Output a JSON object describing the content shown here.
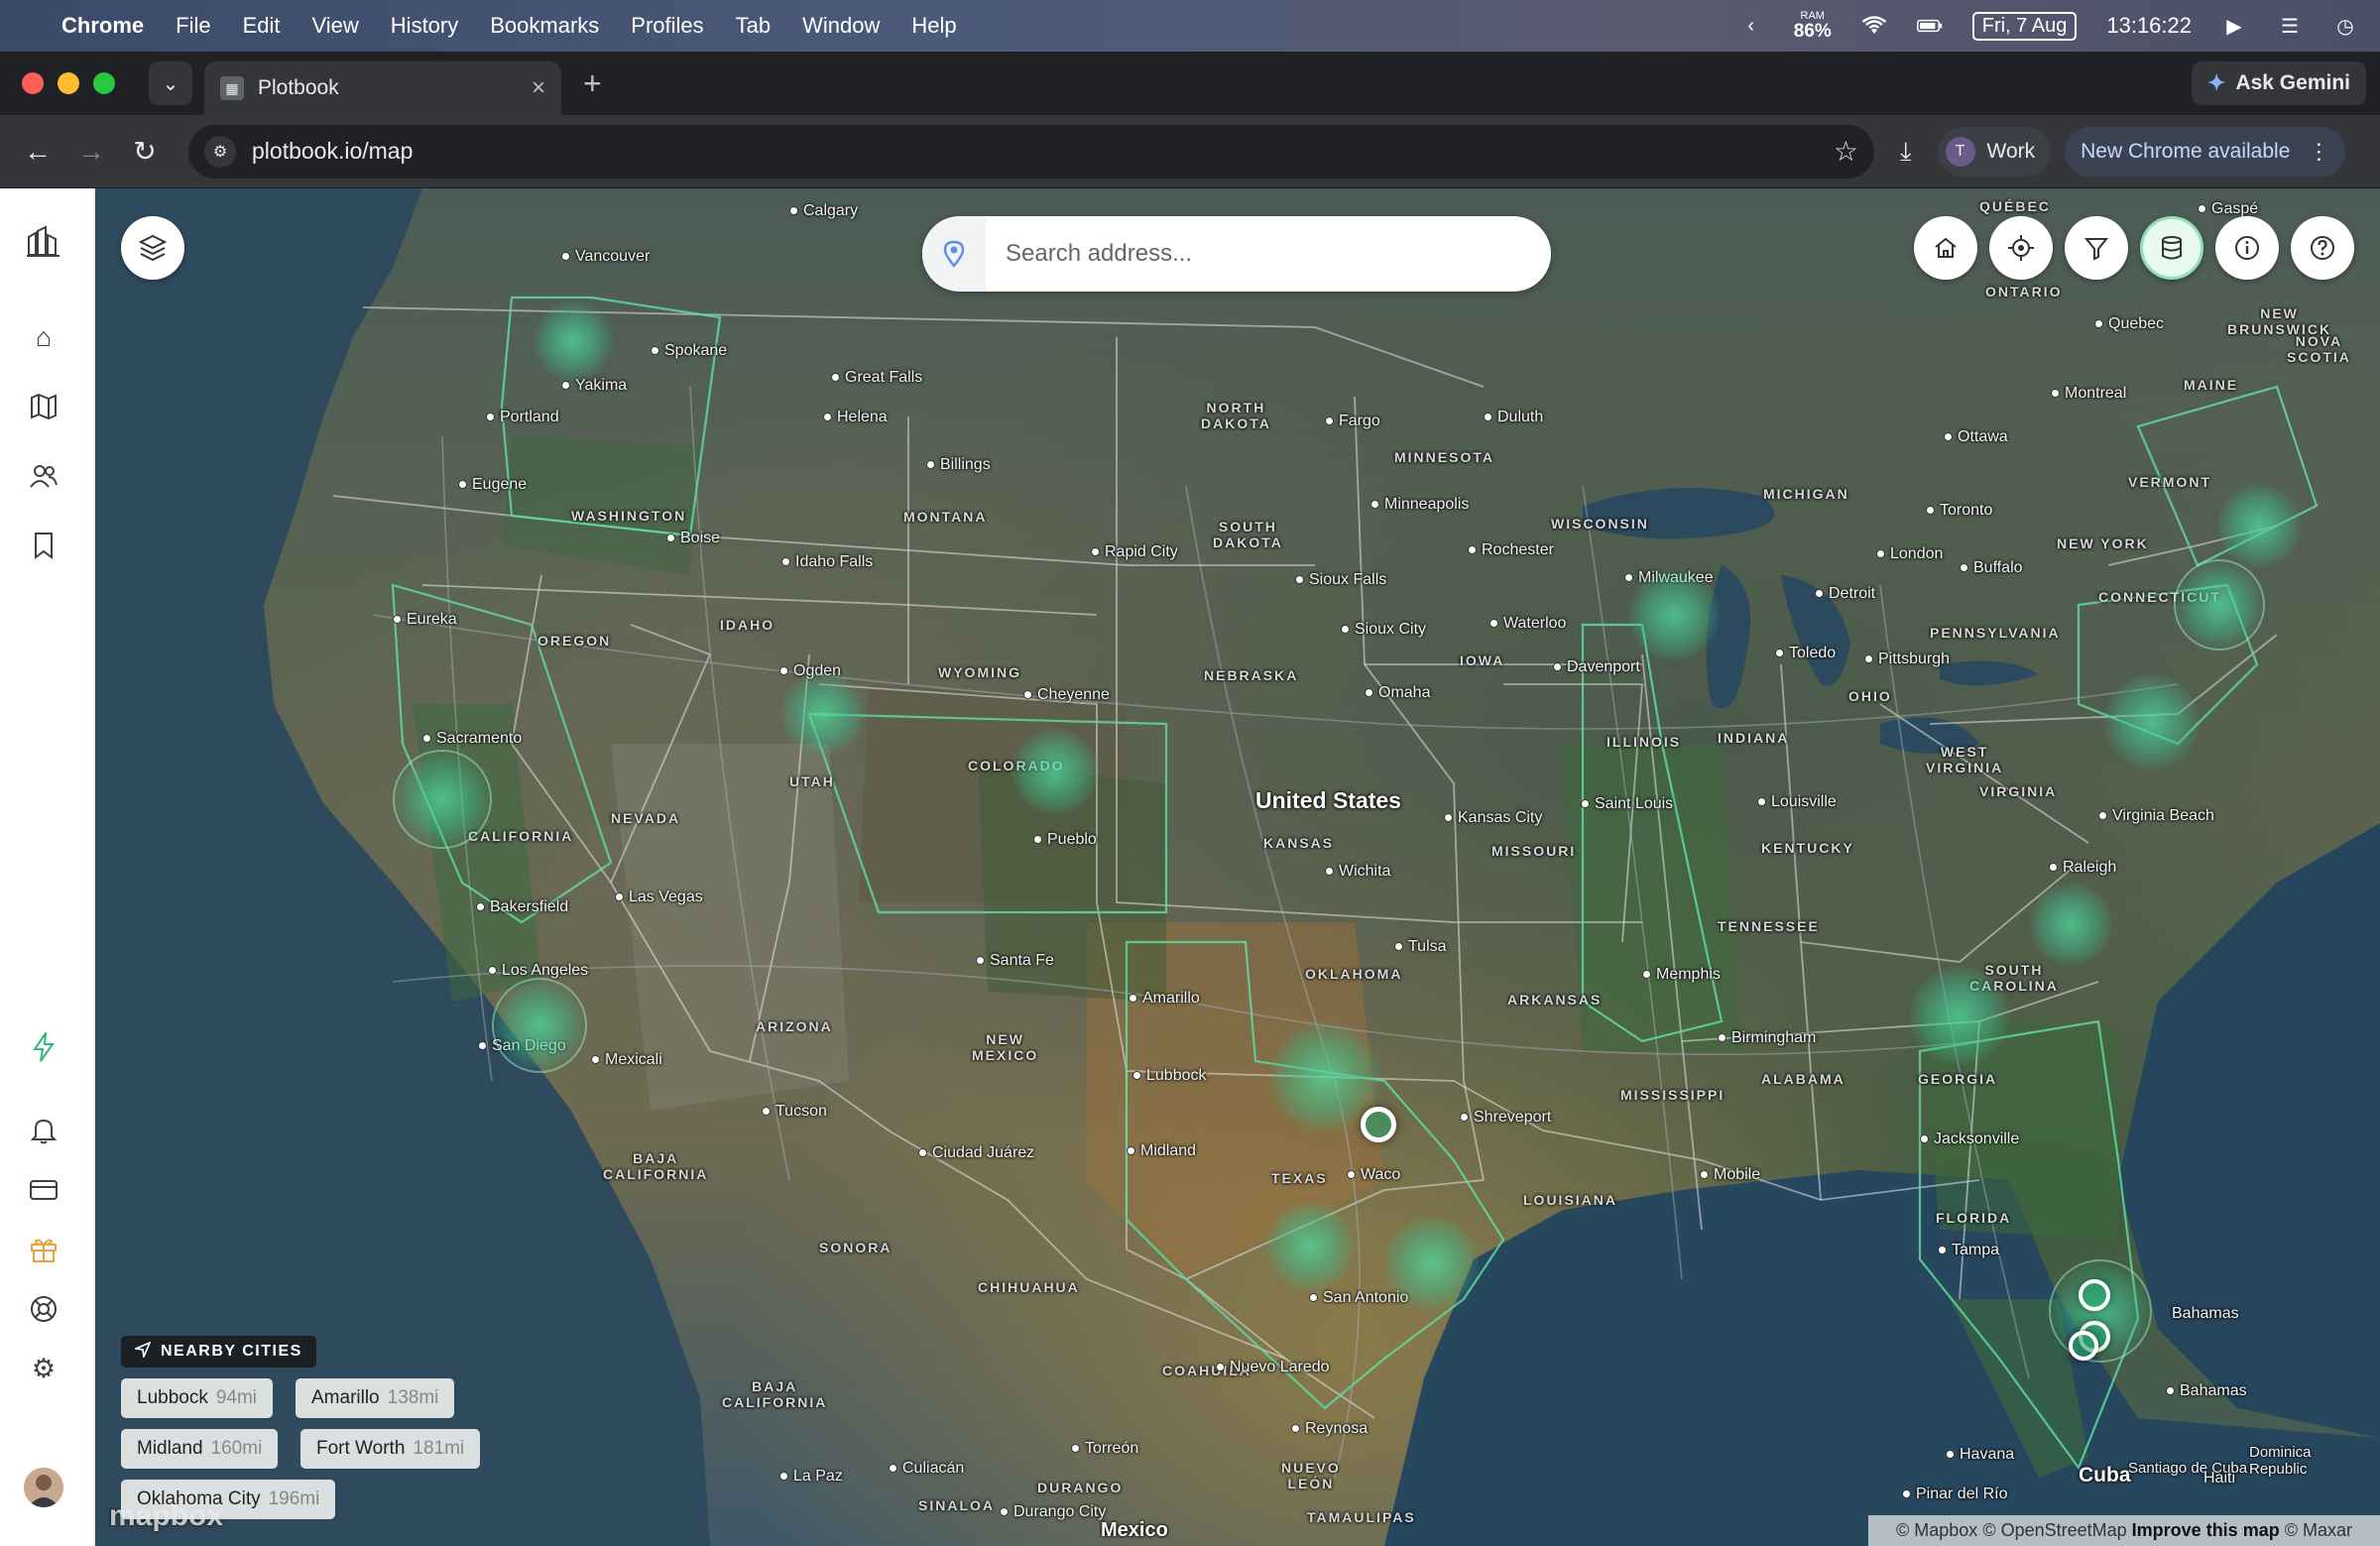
{
  "menubar": {
    "app": "Chrome",
    "items": [
      "File",
      "Edit",
      "View",
      "History",
      "Bookmarks",
      "Profiles",
      "Tab",
      "Window",
      "Help"
    ],
    "ram_label": "RAM",
    "ram_value": "86%",
    "date": "Fri, 7 Aug",
    "time": "13:16:22"
  },
  "browser": {
    "tab_title": "Plotbook",
    "ask_gemini": "Ask Gemini",
    "url": "plotbook.io/map",
    "profile_initial": "T",
    "profile_name": "Work",
    "update_label": "New Chrome available"
  },
  "map": {
    "search_placeholder": "Search address...",
    "country_label": "United States",
    "labels": {
      "calgary": "Calgary",
      "vancouver": "Vancouver",
      "spokane": "Spokane",
      "yakima": "Yakima",
      "portland": "Portland",
      "eugene": "Eugene",
      "eureka": "Eureka",
      "sacramento": "Sacramento",
      "bakersfield": "Bakersfield",
      "los_angeles": "Los Angeles",
      "san_diego": "San Diego",
      "mexicali": "Mexicali",
      "las_vegas": "Las Vegas",
      "boise": "Boise",
      "idaho_falls": "Idaho Falls",
      "ogden": "Ogden",
      "great_falls": "Great Falls",
      "helena": "Helena",
      "billings": "Billings",
      "rapid_city": "Rapid City",
      "cheyenne": "Cheyenne",
      "pueblo": "Pueblo",
      "santa_fe": "Santa Fe",
      "tucson": "Tucson",
      "ciudad_juarez": "Ciudad Juárez",
      "amarillo": "Amarillo",
      "lubbock": "Lubbock",
      "midland": "Midland",
      "fargo": "Fargo",
      "duluth": "Duluth",
      "minneapolis": "Minneapolis",
      "rochester": "Rochester",
      "sioux_falls": "Sioux Falls",
      "sioux_city": "Sioux City",
      "omaha": "Omaha",
      "waterloo": "Waterloo",
      "davenport": "Davenport",
      "milwaukee": "Milwaukee",
      "detroit": "Detroit",
      "toledo": "Toledo",
      "pittsburgh": "Pittsburgh",
      "toronto": "Toronto",
      "london": "London",
      "buffalo": "Buffalo",
      "ottawa": "Ottawa",
      "montreal": "Montreal",
      "quebec": "Quebec",
      "gaspe": "Gaspé",
      "kansas_city": "Kansas City",
      "saint_louis": "Saint Louis",
      "wichita": "Wichita",
      "tulsa": "Tulsa",
      "louisville": "Louisville",
      "virginia_beach": "Virginia Beach",
      "raleigh": "Raleigh",
      "memphis": "Memphis",
      "birmingham": "Birmingham",
      "shreveport": "Shreveport",
      "waco": "Waco",
      "san_antonio": "San Antonio",
      "jacksonville": "Jacksonville",
      "mobile": "Mobile",
      "tampa": "Tampa",
      "nuevo_laredo": "Nuevo Laredo",
      "reynosa": "Reynosa",
      "torreon": "Torreón",
      "culiacan": "Culiacán",
      "durango": "Durango City",
      "la_paz": "La Paz",
      "havana": "Havana",
      "cuba": "Cuba",
      "bahamas": "Bahamas",
      "mexico": "Mexico",
      "pinar": "Pinar del Río",
      "santiago": "Santiago de Cuba",
      "haiti": "Haiti",
      "dominican": "Dominica\nRepublic"
    },
    "states": {
      "wa": "WASHINGTON",
      "or": "OREGON",
      "ca": "CALIFORNIA",
      "nv": "NEVADA",
      "id": "IDAHO",
      "mt": "MONTANA",
      "wy": "WYOMING",
      "ut": "UTAH",
      "co": "COLORADO",
      "az": "ARIZONA",
      "nm": "NEW\nMEXICO",
      "nd": "NORTH\nDAKOTA",
      "sd": "SOUTH\nDAKOTA",
      "ne": "NEBRASKA",
      "ks": "KANSAS",
      "ok": "OKLAHOMA",
      "tx": "TEXAS",
      "mn": "MINNESOTA",
      "ia": "IOWA",
      "mo": "MISSOURI",
      "ar": "ARKANSAS",
      "la": "LOUISIANA",
      "wi": "WISCONSIN",
      "il": "ILLINOIS",
      "mi": "MICHIGAN",
      "in": "INDIANA",
      "oh": "OHIO",
      "ky": "KENTUCKY",
      "tn": "TENNESSEE",
      "ms": "MISSISSIPPI",
      "al": "ALABAMA",
      "ga": "GEORGIA",
      "fl": "FLORIDA",
      "sc": "SOUTH\nCAROLINA",
      "va": "VIRGINIA",
      "wv": "WEST\nVIRGINIA",
      "pa": "PENNSYLVANIA",
      "ny": "NEW YORK",
      "vt": "VERMONT",
      "me": "MAINE",
      "ontario": "ONTARIO",
      "quebec": "QUÉBEC",
      "nb": "NEW\nBRUNSWICK",
      "nova": "NOVA\nSCOTIA",
      "sonora": "SONORA",
      "chihuahua": "CHIHUAHUA",
      "coahuila": "COAHUILA",
      "baja": "BAJA\nCALIFORNIA",
      "nuevo_leon": "NUEVO\nLEÓN",
      "tamaulipas": "TAMAULIPAS",
      "sinaloa": "SINALOA",
      "durango_st": "DURANGO",
      "conn": "CONNECTICUT",
      "baja_sur": "BAJA\nCALIFORNIA"
    }
  },
  "nearby": {
    "heading": "NEARBY CITIES",
    "cities": [
      {
        "name": "Lubbock",
        "dist": "94mi"
      },
      {
        "name": "Amarillo",
        "dist": "138mi"
      },
      {
        "name": "Midland",
        "dist": "160mi"
      },
      {
        "name": "Fort Worth",
        "dist": "181mi"
      },
      {
        "name": "Oklahoma City",
        "dist": "196mi"
      }
    ]
  },
  "attribution": {
    "mapbox": "© Mapbox",
    "osm": "© OpenStreetMap",
    "improve": "Improve this map",
    "maxar": "© Maxar"
  },
  "logo_text": "mapbox",
  "colors": {
    "marker": "#3cc08c",
    "accent": "#5b8def"
  }
}
